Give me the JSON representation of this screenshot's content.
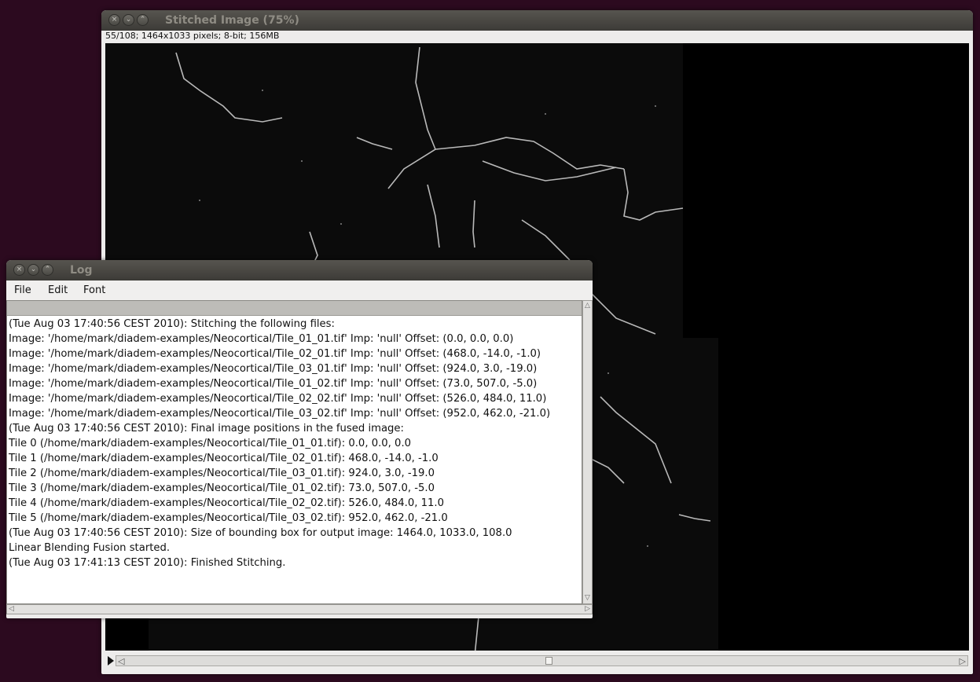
{
  "image_window": {
    "title": "Stitched Image (75%)",
    "info": "55/108; 1464x1033 pixels; 8-bit; 156MB",
    "slider": {
      "value": 55,
      "max": 108
    }
  },
  "log_window": {
    "title": "Log",
    "menu": [
      "File",
      "Edit",
      "Font"
    ],
    "lines": [
      "(Tue Aug 03 17:40:56 CEST 2010): Stitching the following files:",
      "Image: '/home/mark/diadem-examples/Neocortical/Tile_01_01.tif' Imp: 'null' Offset: (0.0, 0.0, 0.0)",
      "Image: '/home/mark/diadem-examples/Neocortical/Tile_02_01.tif' Imp: 'null' Offset: (468.0, -14.0, -1.0)",
      "Image: '/home/mark/diadem-examples/Neocortical/Tile_03_01.tif' Imp: 'null' Offset: (924.0, 3.0, -19.0)",
      "Image: '/home/mark/diadem-examples/Neocortical/Tile_01_02.tif' Imp: 'null' Offset: (73.0, 507.0, -5.0)",
      "Image: '/home/mark/diadem-examples/Neocortical/Tile_02_02.tif' Imp: 'null' Offset: (526.0, 484.0, 11.0)",
      "Image: '/home/mark/diadem-examples/Neocortical/Tile_03_02.tif' Imp: 'null' Offset: (952.0, 462.0, -21.0)",
      "(Tue Aug 03 17:40:56 CEST 2010): Final image positions in the fused image:",
      "Tile 0 (/home/mark/diadem-examples/Neocortical/Tile_01_01.tif): 0.0, 0.0, 0.0",
      "Tile 1 (/home/mark/diadem-examples/Neocortical/Tile_02_01.tif): 468.0, -14.0, -1.0",
      "Tile 2 (/home/mark/diadem-examples/Neocortical/Tile_03_01.tif): 924.0, 3.0, -19.0",
      "Tile 3 (/home/mark/diadem-examples/Neocortical/Tile_01_02.tif): 73.0, 507.0, -5.0",
      "Tile 4 (/home/mark/diadem-examples/Neocortical/Tile_02_02.tif): 526.0, 484.0, 11.0",
      "Tile 5 (/home/mark/diadem-examples/Neocortical/Tile_03_02.tif): 952.0, 462.0, -21.0",
      "(Tue Aug 03 17:40:56 CEST 2010): Size of bounding box for output image: 1464.0, 1033.0, 108.0",
      "Linear Blending Fusion started.",
      "(Tue Aug 03 17:41:13 CEST 2010): Finished Stitching."
    ]
  },
  "colors": {
    "desktop": "#2c0a1f",
    "titlebar": "#3c3b37",
    "title_text": "#8f8c84"
  }
}
